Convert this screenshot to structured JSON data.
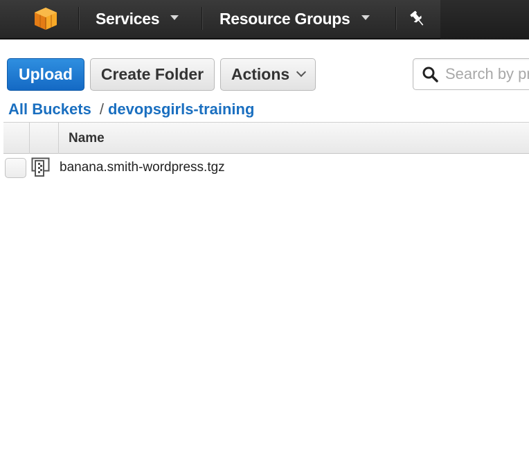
{
  "nav": {
    "logo_icon": "aws-cube-icon",
    "services_label": "Services",
    "resource_groups_label": "Resource Groups",
    "pin_icon": "pin-icon",
    "accent_color": "#f0a11c",
    "bar_color": "#333333"
  },
  "toolbar": {
    "upload_label": "Upload",
    "create_folder_label": "Create Folder",
    "actions_label": "Actions",
    "search_placeholder": "Search by prefix",
    "primary_color": "#1f7cd6"
  },
  "breadcrumb": {
    "root_label": "All Buckets",
    "separator": "/",
    "bucket_label": "devopsgirls-training"
  },
  "table": {
    "columns": [
      "Name"
    ],
    "rows": [
      {
        "icon": "archive-file-icon",
        "name": "banana.smith-wordpress.tgz"
      }
    ]
  }
}
